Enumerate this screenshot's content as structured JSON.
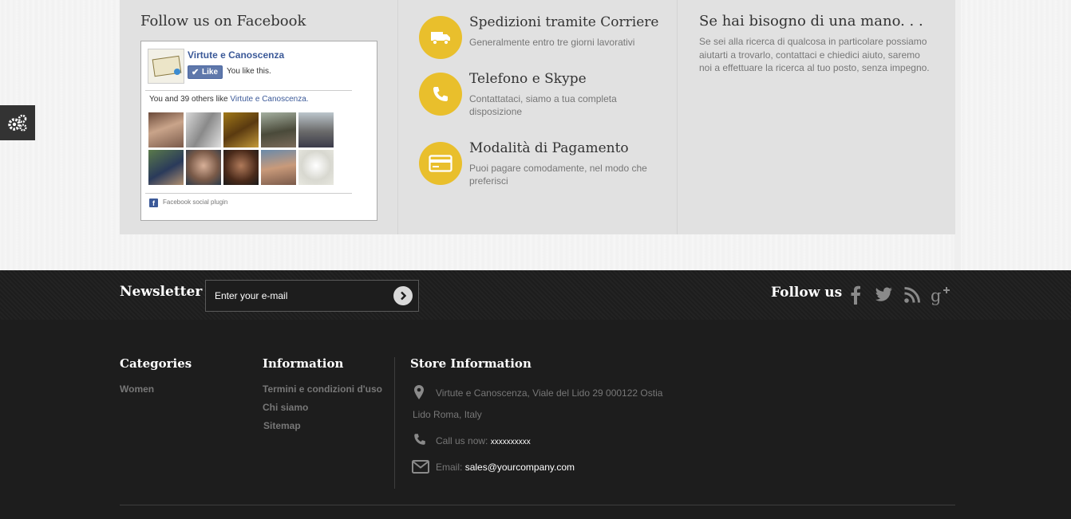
{
  "facebook": {
    "title": "Follow us on Facebook",
    "page_name": "Virtute e Canoscenza",
    "like_button": "Like",
    "you_like": "You like this.",
    "others_prefix": "You and 39 others like ",
    "others_link": "Virtute e Canoscenza.",
    "plugin_label": "Facebook social plugin"
  },
  "services": [
    {
      "title": "Spedizioni tramite Corriere",
      "desc": "Generalmente entro tre giorni lavorativi",
      "icon": "truck-icon"
    },
    {
      "title": "Telefono e Skype",
      "desc": "Contattataci, siamo a tua completa disposizione",
      "icon": "phone-icon"
    },
    {
      "title": "Modalità di Pagamento",
      "desc": "Puoi pagare comodamente, nel modo che preferisci",
      "icon": "credit-card-icon"
    }
  ],
  "help": {
    "title": "Se hai bisogno di una mano. . .",
    "text": "Se sei alla ricerca di qualcosa in particolare possiamo aiutarti a trovarlo, contattaci e chiedici aiuto, saremo noi a effettuare la ricerca al tuo posto, senza impegno."
  },
  "newsletter": {
    "label": "Newsletter",
    "placeholder": "Enter your e-mail"
  },
  "follow": {
    "label": "Follow us",
    "icons": [
      "facebook-icon",
      "twitter-icon",
      "rss-icon",
      "google-plus-icon"
    ]
  },
  "categories": {
    "title": "Categories",
    "items": [
      "Women"
    ]
  },
  "information": {
    "title": "Information",
    "items": [
      "Termini e condizioni d'uso",
      "Chi siamo",
      "Sitemap"
    ]
  },
  "store": {
    "title": "Store Information",
    "address_line1": "Virtute e Canoscenza, Viale del Lido 29 000122 Ostia",
    "address_line2": "Lido Roma, Italy",
    "call_label": "Call us now: ",
    "call_value": "xxxxxxxxxx",
    "email_label": "Email: ",
    "email_value": "sales@yourcompany.com"
  },
  "colors": {
    "accent": "#e9bf2c",
    "footer_bg": "#1d1d1d",
    "panel_bg": "#e1e1e1"
  }
}
